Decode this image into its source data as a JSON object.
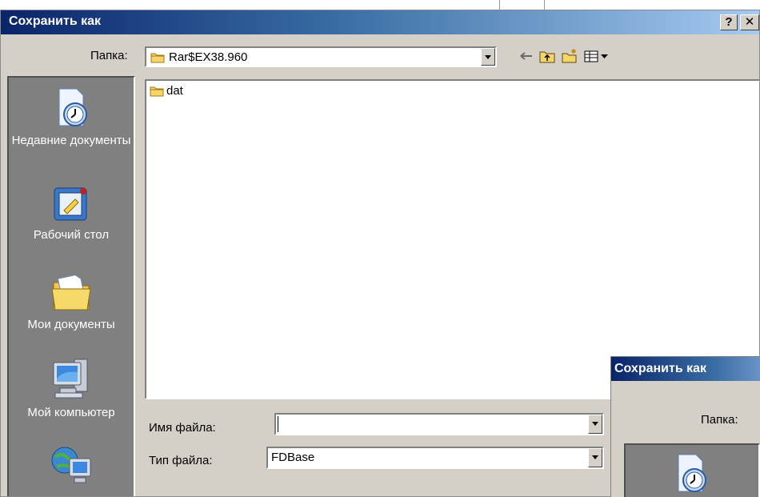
{
  "dialog": {
    "title": "Сохранить как",
    "help_label": "?",
    "close_label": "✕"
  },
  "lookin": {
    "label": "Папка:",
    "value": "Rar$EX38.960"
  },
  "places": [
    {
      "label": "Недавние документы",
      "icon": "recent-documents-icon"
    },
    {
      "label": "Рабочий стол",
      "icon": "desktop-icon"
    },
    {
      "label": "Мои документы",
      "icon": "my-documents-icon"
    },
    {
      "label": "Мой компьютер",
      "icon": "my-computer-icon"
    },
    {
      "label": "",
      "icon": "network-icon"
    }
  ],
  "files": [
    {
      "name": "dat",
      "icon": "folder-icon"
    }
  ],
  "form": {
    "filename_label": "Имя файла:",
    "filename_value": "",
    "filetype_label": "Тип файла:",
    "filetype_value": "FDBase"
  },
  "second_dialog": {
    "title": "Сохранить как",
    "lookin_label": "Папка:"
  },
  "colors": {
    "title_start": "#0a246a",
    "title_end": "#a6caf0",
    "face": "#d4d0c8",
    "places_bg": "#808080"
  }
}
